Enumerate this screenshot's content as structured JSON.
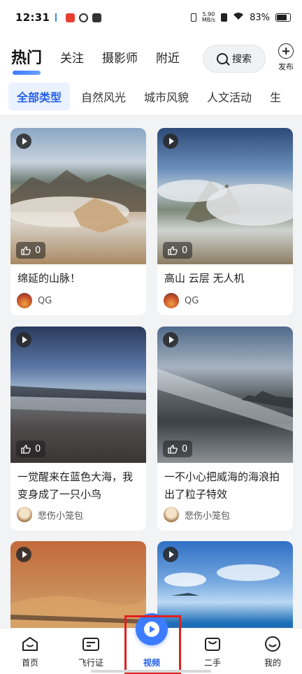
{
  "status_bar": {
    "time": "12:31",
    "net_speed_value": "5.90",
    "net_speed_unit": "MB/s",
    "battery": "83%"
  },
  "top_tabs": [
    {
      "label": "热门",
      "active": true
    },
    {
      "label": "关注",
      "active": false
    },
    {
      "label": "摄影师",
      "active": false
    },
    {
      "label": "附近",
      "active": false
    }
  ],
  "search": {
    "label": "搜索"
  },
  "publish": {
    "label": "发布"
  },
  "categories": [
    {
      "label": "全部类型",
      "active": true
    },
    {
      "label": "自然风光",
      "active": false
    },
    {
      "label": "城市风貌",
      "active": false
    },
    {
      "label": "人文活动",
      "active": false
    },
    {
      "label": "生",
      "active": false
    }
  ],
  "feed": [
    {
      "title": "绵延的山脉！",
      "likes": "0",
      "author": "QG"
    },
    {
      "title": "高山 云层 无人机",
      "likes": "0",
      "author": "QG"
    },
    {
      "title": "一觉醒来在蓝色大海，我变身成了一只小鸟",
      "likes": "0",
      "author": "悲伤小笼包"
    },
    {
      "title": "一不小心把威海的海浪拍出了粒子特效",
      "likes": "0",
      "author": "悲伤小笼包"
    },
    {
      "title": "",
      "likes": "",
      "author": ""
    },
    {
      "title": "",
      "likes": "",
      "author": ""
    }
  ],
  "bottom_nav": [
    {
      "label": "首页",
      "icon": "home-icon"
    },
    {
      "label": "飞行证",
      "icon": "license-card-icon"
    },
    {
      "label": "视频",
      "icon": "video-play-icon",
      "active": true
    },
    {
      "label": "二手",
      "icon": "shopping-bag-icon"
    },
    {
      "label": "我的",
      "icon": "profile-smile-icon"
    }
  ],
  "colors": {
    "accent": "#2560e8",
    "video_button": "#3d7bff",
    "highlight_box": "#e02020"
  }
}
